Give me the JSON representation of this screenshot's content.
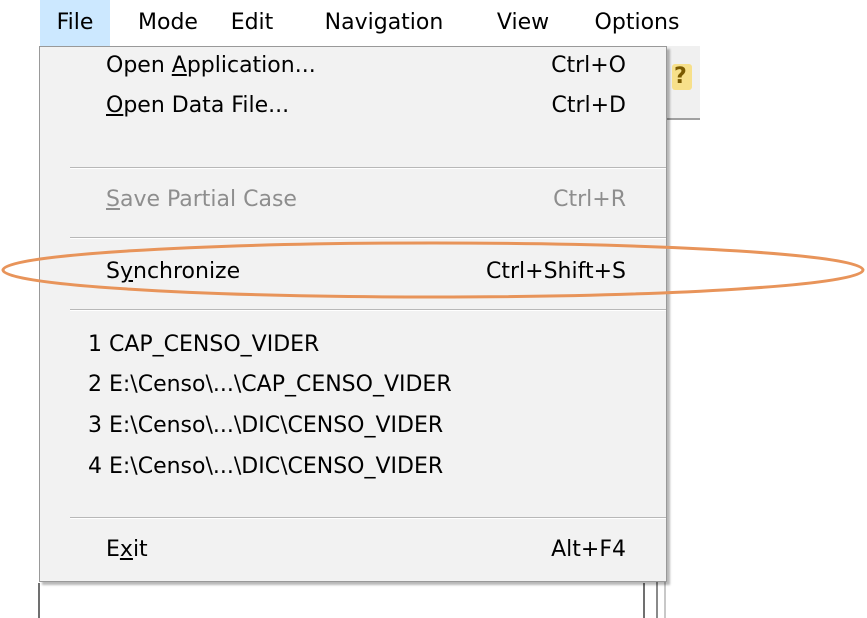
{
  "menubar": {
    "items": [
      {
        "label": "File"
      },
      {
        "label": "Mode"
      },
      {
        "label": "Edit"
      },
      {
        "label": "Navigation"
      },
      {
        "label": "View"
      },
      {
        "label": "Options"
      }
    ]
  },
  "file_menu": {
    "open_application": {
      "pre": "Open ",
      "accel": "A",
      "post": "pplication...",
      "shortcut": "Ctrl+O"
    },
    "open_data_file": {
      "pre": "",
      "accel": "O",
      "post": "pen Data File...",
      "shortcut": "Ctrl+D"
    },
    "save_partial_case": {
      "pre": "",
      "accel": "S",
      "post": "ave Partial Case",
      "shortcut": "Ctrl+R"
    },
    "synchronize": {
      "pre": "S",
      "accel": "y",
      "post": "nchronize",
      "shortcut": "Ctrl+Shift+S"
    },
    "recent": [
      "1 CAP_CENSO_VIDER",
      "2 E:\\Censo\\...\\CAP_CENSO_VIDER",
      "3 E:\\Censo\\...\\DIC\\CENSO_VIDER",
      "4 E:\\Censo\\...\\DIC\\CENSO_VIDER"
    ],
    "exit": {
      "pre": "E",
      "accel": "x",
      "post": "it",
      "shortcut": "Alt+F4"
    }
  },
  "colors": {
    "menu_background": "#f2f2f2",
    "active_menubar_highlight": "#cce8ff",
    "disabled_text": "#8e8e8e",
    "annotation_ellipse": "#e8945a"
  },
  "icons": {
    "toolbar_help": "help-question-icon"
  }
}
